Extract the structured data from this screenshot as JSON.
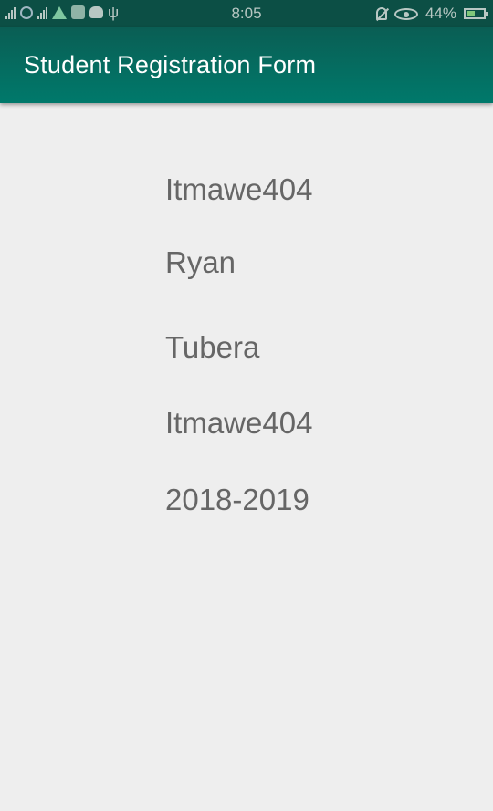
{
  "status_bar": {
    "time": "8:05",
    "battery": "44%"
  },
  "app_bar": {
    "title": "Student Registration Form"
  },
  "fields": [
    {
      "value": "Itmawe404"
    },
    {
      "value": "Ryan"
    },
    {
      "value": "Tubera"
    },
    {
      "value": "Itmawe404"
    },
    {
      "value": "2018-2019"
    }
  ],
  "colors": {
    "status_bar": "#0c4f45",
    "app_bar": "#00796b",
    "background": "#eeeeee",
    "text": "#666666"
  }
}
